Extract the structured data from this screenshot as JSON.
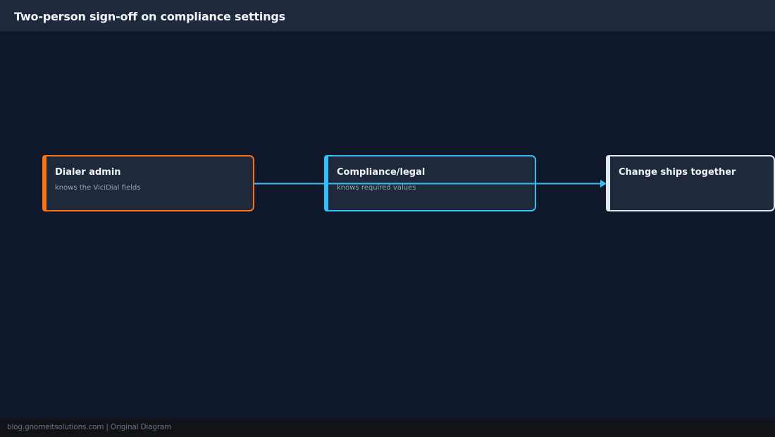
{
  "header": {
    "title": "Two-person sign-off on compliance settings"
  },
  "diagram": {
    "nodes": [
      {
        "id": "dialer-admin",
        "title": "Dialer admin",
        "subtitle": "knows the ViciDial fields",
        "color": "#f97316"
      },
      {
        "id": "compliance-legal",
        "title": "Compliance/legal",
        "subtitle": "knows required values",
        "color": "#38bdf8"
      },
      {
        "id": "change-ships",
        "title": "Change ships together",
        "subtitle": "",
        "color": "#e2e8f0"
      }
    ],
    "edges": [
      {
        "from": "dialer-admin",
        "to": "change-ships",
        "color": "#38bdf8"
      }
    ]
  },
  "footer": {
    "text": "blog.gnomeitsolutions.com | Original Diagram"
  },
  "colors": {
    "background": "#0f172a",
    "header_bg": "#1e293b",
    "node_bg": "#1e293b",
    "footer_bg": "#111318"
  }
}
